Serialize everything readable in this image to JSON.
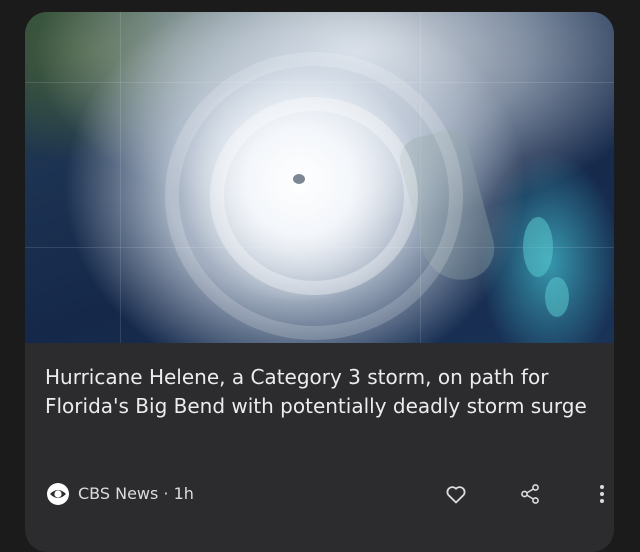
{
  "article": {
    "image_icon": "hurricane-satellite-image",
    "headline": "Hurricane Helene, a Category 3 storm, on path for Florida's Big Bend with potentially deadly storm surge",
    "source": "CBS News",
    "age": "1h",
    "source_line": "CBS News · 1h",
    "source_logo_icon": "cbs-eye-logo"
  },
  "actions": {
    "like_icon": "heart-icon",
    "share_icon": "share-icon",
    "more_icon": "more-vertical-icon"
  },
  "colors": {
    "background": "#1b1b1c",
    "card": "#2c2c2e",
    "headline_text": "#ececef",
    "meta_text": "#dcdce0"
  }
}
